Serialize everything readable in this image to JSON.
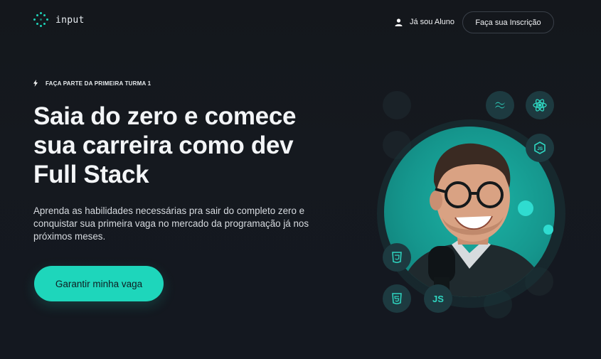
{
  "header": {
    "logo_text": "input",
    "student_link": "Já sou Aluno",
    "signup_button": "Faça sua Inscrição"
  },
  "hero": {
    "eyebrow": "FAÇA PARTE DA PRIMEIRA TURMA 1",
    "title_lines": [
      "Saia do zero e comece",
      "sua carreira como dev",
      "Full Stack"
    ],
    "description_lines": [
      "Aprenda as habilidades necessárias pra sair do completo zero e",
      "conquistar sua primeira vaga no mercado da programação já nos",
      "próximos meses."
    ],
    "cta": "Garantir minha vaga"
  },
  "visual": {
    "js_badge_1": "JS",
    "js_badge_2": "JS",
    "badge_icons": [
      "tailwind-icon",
      "react-icon",
      "nodejs-icon",
      "css3-icon",
      "html5-icon",
      "javascript-icon"
    ]
  },
  "colors": {
    "background": "#14171c",
    "accent": "#1ed6bb",
    "badge": "#1d3a40"
  }
}
